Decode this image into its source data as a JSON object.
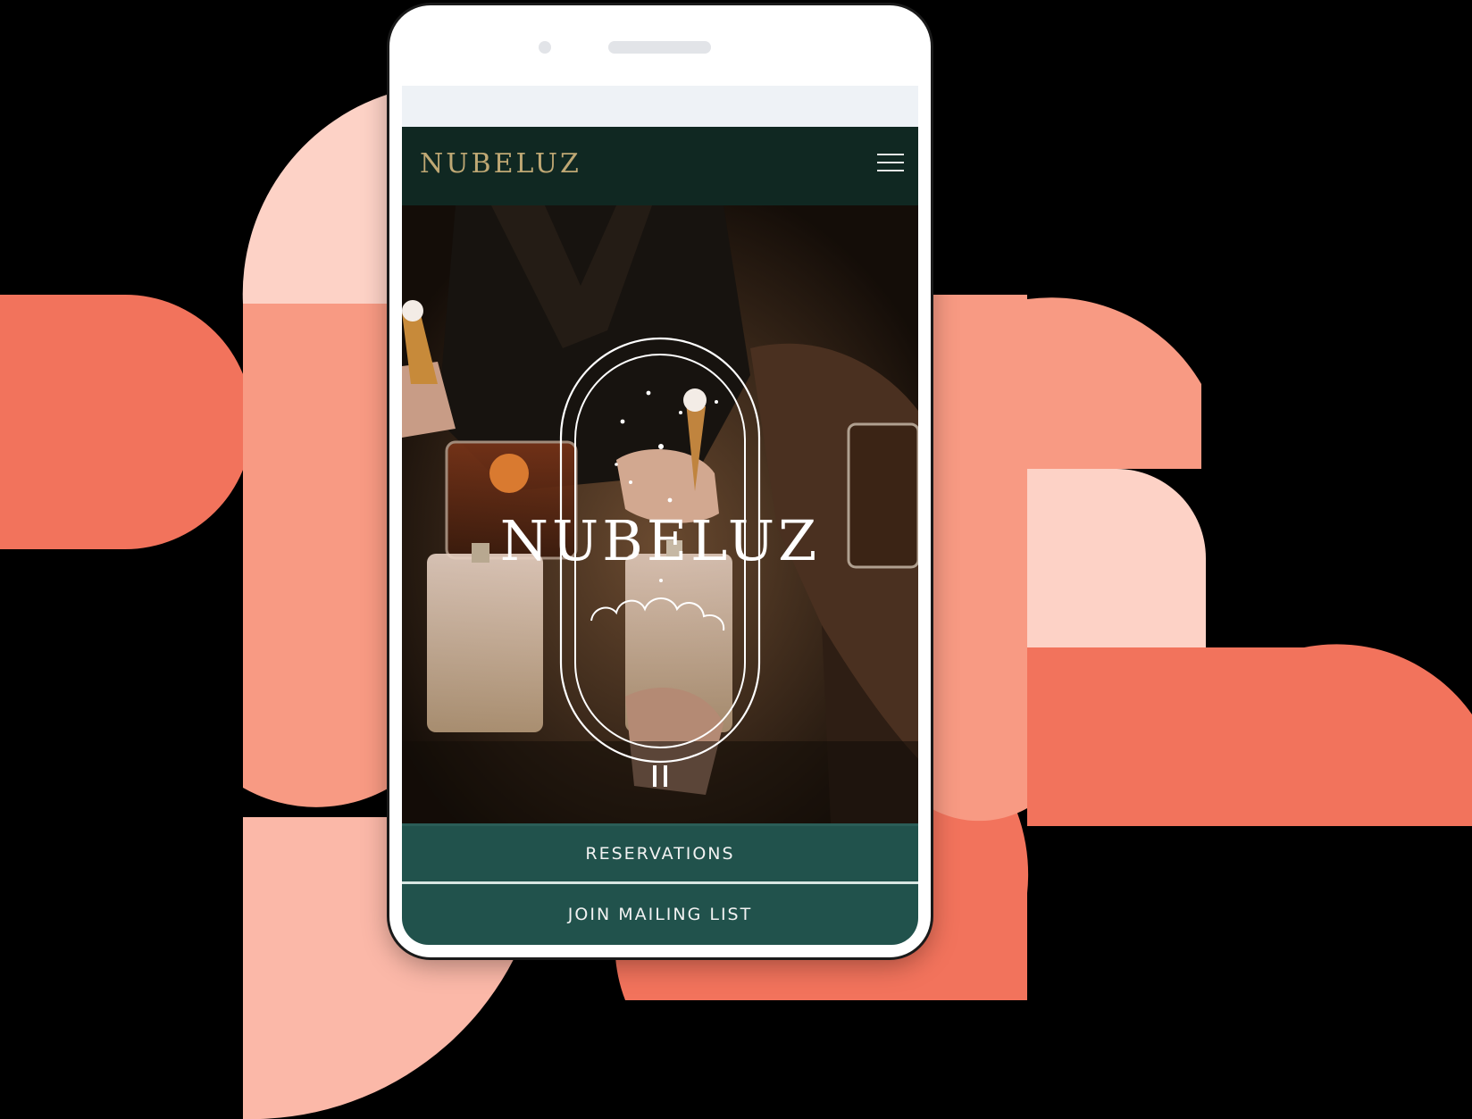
{
  "header": {
    "brand": "NUBELUZ",
    "menu_icon": "hamburger-menu-icon"
  },
  "hero": {
    "logo_text": "NUBELUZ",
    "logo_icon": "arch-cloud-stars-logo-icon",
    "pause_icon": "pause-icon"
  },
  "actions": {
    "reservations_label": "RESERVATIONS",
    "mailing_list_label": "JOIN MAILING LIST"
  },
  "colors": {
    "header_bg": "#102822",
    "brand_gold": "#bfa874",
    "cta_bg": "#21524c",
    "decor_coral": "#f2735c",
    "decor_salmon": "#f89a83",
    "decor_pink": "#fbb8a8",
    "decor_blush": "#fdd2c6"
  }
}
